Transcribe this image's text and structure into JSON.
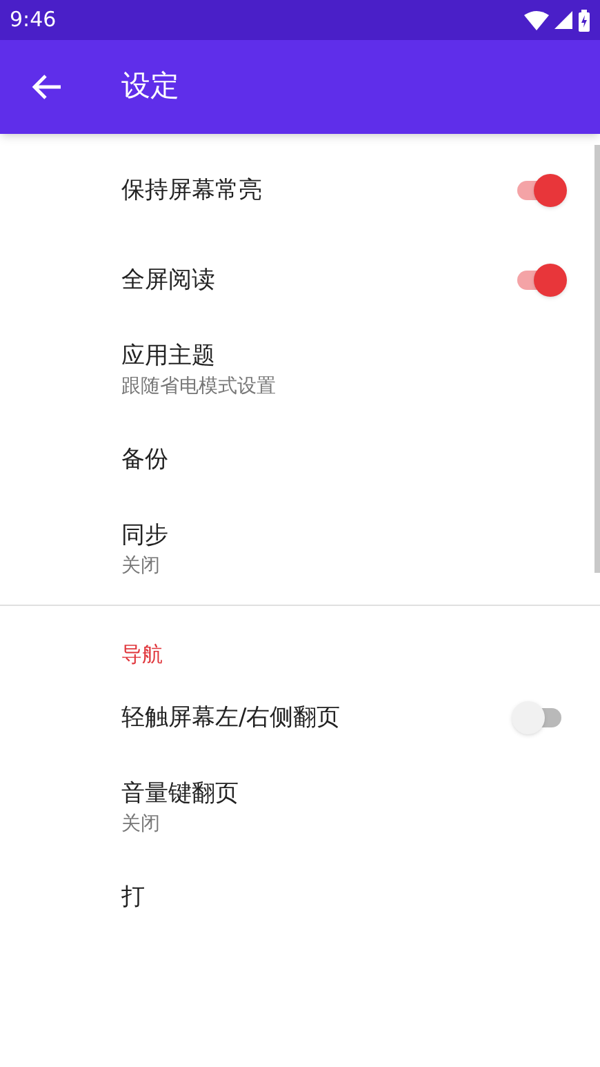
{
  "status_bar": {
    "time": "9:46"
  },
  "app_bar": {
    "title": "设定"
  },
  "sections": [
    {
      "items": [
        {
          "kind": "switch",
          "title": "保持屏幕常亮",
          "on": true
        },
        {
          "kind": "switch",
          "title": "全屏阅读",
          "on": true
        },
        {
          "kind": "text",
          "title": "应用主题",
          "summary": "跟随省电模式设置"
        },
        {
          "kind": "text",
          "title": "备份"
        },
        {
          "kind": "text",
          "title": "同步",
          "summary": "关闭"
        }
      ]
    },
    {
      "header": "导航",
      "items": [
        {
          "kind": "switch",
          "title": "轻触屏幕左/右侧翻页",
          "on": false
        },
        {
          "kind": "text",
          "title": "音量键翻页",
          "summary": "关闭"
        },
        {
          "kind": "text",
          "title": "打"
        }
      ]
    }
  ]
}
